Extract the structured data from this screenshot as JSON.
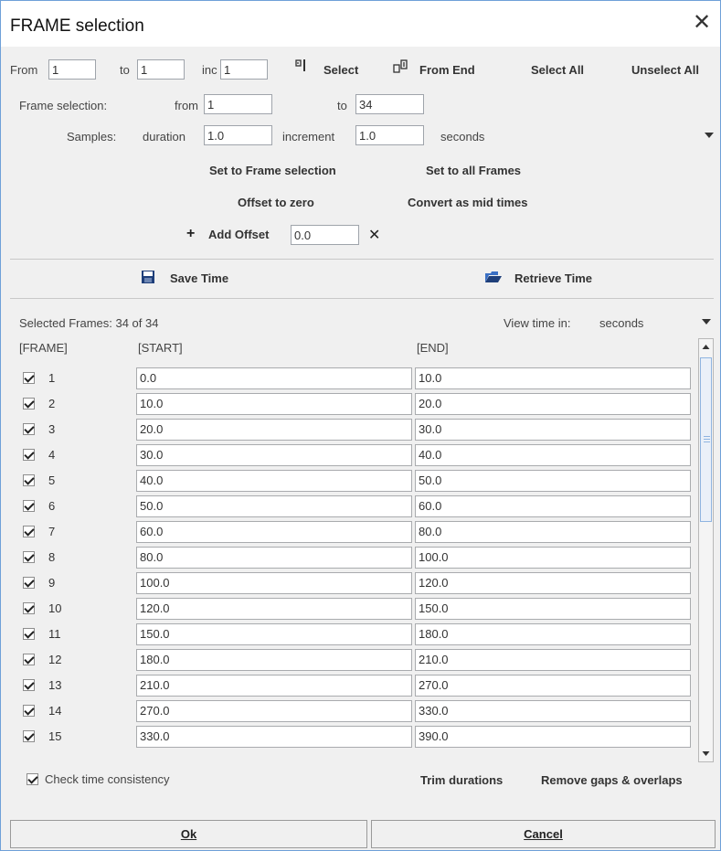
{
  "window": {
    "title": "FRAME selection"
  },
  "range": {
    "from_label": "From",
    "from_value": "1",
    "to_label": "to",
    "to_value": "1",
    "inc_label": "inc",
    "inc_value": "1",
    "select_label": "Select",
    "from_end_label": "From End",
    "select_all_label": "Select All",
    "unselect_all_label": "Unselect All"
  },
  "frame_selection": {
    "label": "Frame selection:",
    "from_label": "from",
    "from_value": "1",
    "to_label": "to",
    "to_value": "34"
  },
  "samples": {
    "label": "Samples:",
    "duration_label": "duration",
    "duration_value": "1.0",
    "increment_label": "increment",
    "increment_value": "1.0",
    "unit": "seconds"
  },
  "actions": {
    "set_to_frame_selection": "Set to Frame selection",
    "set_to_all_frames": "Set to all Frames",
    "offset_to_zero": "Offset to zero",
    "convert_as_mid_times": "Convert as mid times",
    "add_offset_label": "Add Offset",
    "add_offset_value": "0.0"
  },
  "time_io": {
    "save_label": "Save Time",
    "retrieve_label": "Retrieve Time"
  },
  "table": {
    "summary": "Selected Frames: 34 of 34",
    "view_time_label": "View time in:",
    "view_time_unit": "seconds",
    "headers": {
      "frame": "[FRAME]",
      "start": "[START]",
      "end": "[END]"
    },
    "rows": [
      {
        "frame": "1",
        "start": "0.0",
        "end": "10.0"
      },
      {
        "frame": "2",
        "start": "10.0",
        "end": "20.0"
      },
      {
        "frame": "3",
        "start": "20.0",
        "end": "30.0"
      },
      {
        "frame": "4",
        "start": "30.0",
        "end": "40.0"
      },
      {
        "frame": "5",
        "start": "40.0",
        "end": "50.0"
      },
      {
        "frame": "6",
        "start": "50.0",
        "end": "60.0"
      },
      {
        "frame": "7",
        "start": "60.0",
        "end": "80.0"
      },
      {
        "frame": "8",
        "start": "80.0",
        "end": "100.0"
      },
      {
        "frame": "9",
        "start": "100.0",
        "end": "120.0"
      },
      {
        "frame": "10",
        "start": "120.0",
        "end": "150.0"
      },
      {
        "frame": "11",
        "start": "150.0",
        "end": "180.0"
      },
      {
        "frame": "12",
        "start": "180.0",
        "end": "210.0"
      },
      {
        "frame": "13",
        "start": "210.0",
        "end": "270.0"
      },
      {
        "frame": "14",
        "start": "270.0",
        "end": "330.0"
      },
      {
        "frame": "15",
        "start": "330.0",
        "end": "390.0"
      }
    ]
  },
  "footer": {
    "check_time_consistency": "Check time consistency",
    "trim_durations": "Trim durations",
    "remove_gaps": "Remove gaps & overlaps",
    "ok_label": "Ok",
    "cancel_label": "Cancel"
  },
  "colors": {
    "accent_border": "#6fa0d8",
    "save_icon": "#1f3f7a",
    "folder_icon": "#3a6fc4"
  }
}
